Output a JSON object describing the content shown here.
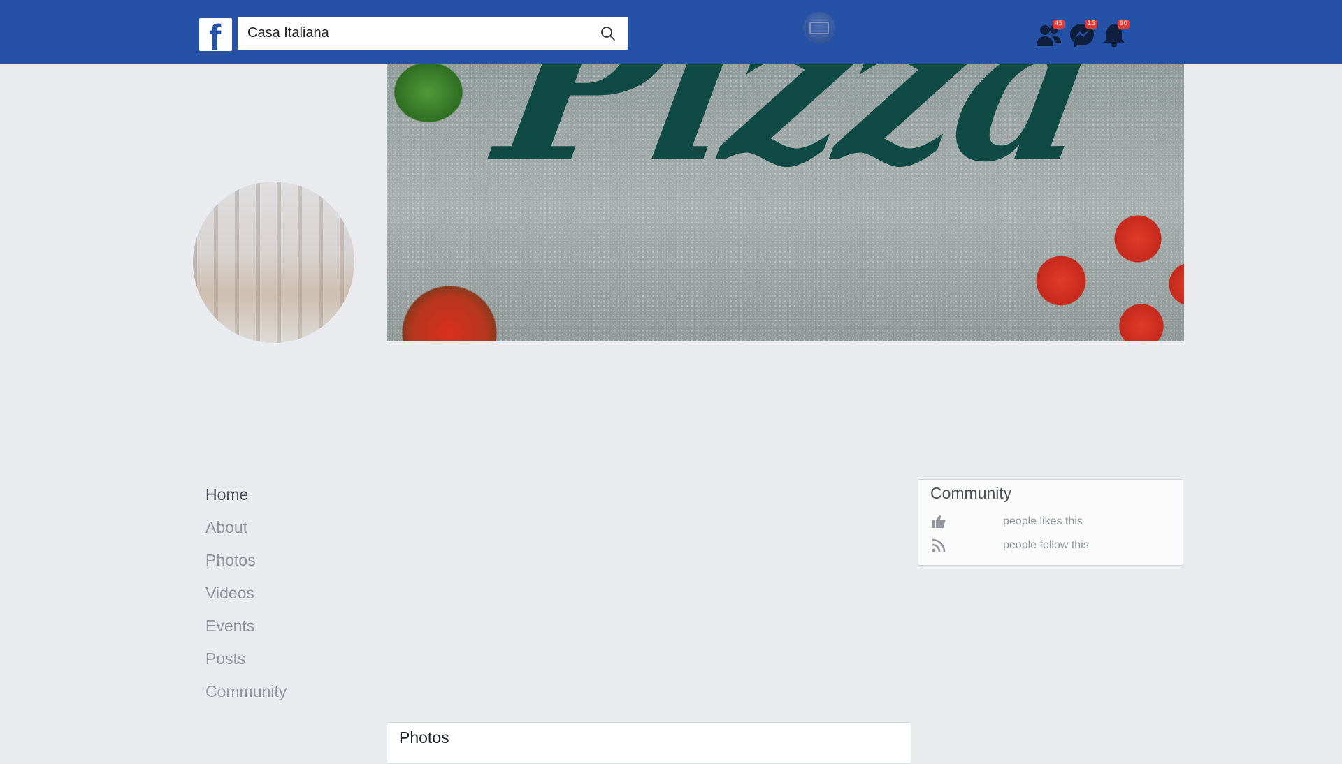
{
  "header": {
    "logo_letter": "f",
    "search_value": "Casa Italiana",
    "badges": {
      "friends": "45",
      "messages": "15",
      "notifications": "90"
    }
  },
  "cover": {
    "word": "Pizza"
  },
  "nav": {
    "items": [
      "Home",
      "About",
      "Photos",
      "Videos",
      "Events",
      "Posts",
      "Community"
    ],
    "active": "Home"
  },
  "community": {
    "title": "Community",
    "likes_text": "people likes this",
    "follow_text": "people follow this"
  },
  "photos": {
    "title": "Photos"
  },
  "colors": {
    "brand": "#2551a7",
    "badge": "#e53935",
    "icon_dark": "#0f1f3d",
    "page_bg": "#e9ebee"
  },
  "icons": [
    "search-icon",
    "friends-icon",
    "messenger-icon",
    "bell-icon",
    "thumbs-up-icon",
    "rss-icon"
  ]
}
